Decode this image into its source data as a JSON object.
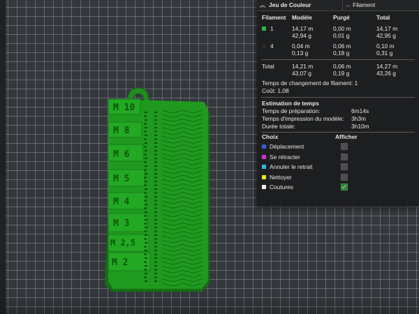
{
  "panel": {
    "view_title": "Jeu de Couleur",
    "view_mode": "Filament",
    "table": {
      "headers": [
        "Filament",
        "Modèle",
        "Purgé",
        "Total"
      ],
      "rows": [
        {
          "id": "1",
          "color": "#2bb34a",
          "model": [
            "14,17 m",
            "42,94 g"
          ],
          "purged": [
            "0,00 m",
            "0,01 g"
          ],
          "total": [
            "14,17 m",
            "42,95 g"
          ]
        },
        {
          "id": "4",
          "color": "#2a2a2a",
          "model": [
            "0,04 m",
            "0,13 g"
          ],
          "purged": [
            "0,06 m",
            "0,18 g"
          ],
          "total": [
            "0,10 m",
            "0,31 g"
          ]
        }
      ],
      "total_row": {
        "label": "Total",
        "model": [
          "14,21 m",
          "43,07 g"
        ],
        "purged": [
          "0,06 m",
          "0,19 g"
        ],
        "total": [
          "14,27 m",
          "43,26 g"
        ]
      }
    },
    "filament_changes": "Temps de changement de filament:  1",
    "cost": "Coût:  1,08",
    "time_section": {
      "title": "Estimation de temps",
      "items": [
        {
          "label": "Temps de préparation:",
          "value": "6m14s"
        },
        {
          "label": "Temps d'impression du modèle:",
          "value": "3h3m"
        },
        {
          "label": "Durée totale:",
          "value": "3h10m"
        }
      ]
    },
    "choices": {
      "col_choice": "Choix",
      "col_show": "Afficher",
      "items": [
        {
          "label": "Déplacement",
          "color": "#3b5fd0",
          "shown": false
        },
        {
          "label": "Se rétracter",
          "color": "#d02fd0",
          "shown": false
        },
        {
          "label": "Annuler le retrait",
          "color": "#2fb7d6",
          "shown": false
        },
        {
          "label": "Nettoyer",
          "color": "#e6e61e",
          "shown": false
        },
        {
          "label": "Coutures",
          "color": "#f0f0f0",
          "shown": true
        }
      ]
    },
    "icons": {
      "collapse": "chevron-up-icon",
      "dropdown": "chevron-down-icon",
      "check": "check-icon"
    }
  },
  "model": {
    "labels": [
      "M 10",
      "M 8",
      "M 6",
      "M 5",
      "M 4",
      "M 3",
      "M 2,5",
      "M 2"
    ],
    "color": "#1f9a1f"
  }
}
